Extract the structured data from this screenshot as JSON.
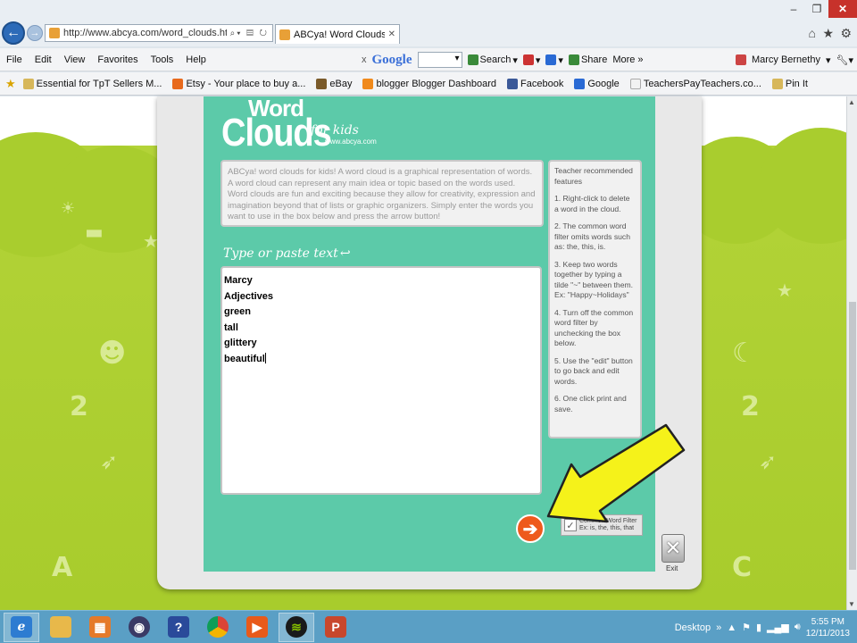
{
  "browser": {
    "url": "http://www.abcya.com/word_clouds.htm",
    "tab_title": "ABCya! Word Clouds for Ki...",
    "menu": [
      "File",
      "Edit",
      "View",
      "Favorites",
      "Tools",
      "Help"
    ],
    "google_toolbar": {
      "close": "x",
      "logo": "Google",
      "search_label": "Search",
      "share_label": "Share",
      "more_label": "More »"
    },
    "user_name": "Marcy Bernethy",
    "favorites": [
      "Essential for TpT Sellers M...",
      "Etsy - Your place to buy a...",
      "eBay",
      "blogger Blogger Dashboard",
      "Facebook",
      "Google",
      "TeachersPayTeachers.co...",
      "Pin It"
    ]
  },
  "app": {
    "logo_word": "Word",
    "logo_clouds": "Clouds",
    "logo_for_kids": "for kids",
    "logo_url": "www.abcya.com",
    "description": "ABCya! word clouds for kids! A word cloud is a graphical representation of words.  A word cloud can represent any main idea or topic based on the words used.  Word clouds are fun and exciting because they allow for creativity, expression and imagination beyond that of lists or graphic organizers.  Simply enter the words you want to use in the box below and press the arrow button!",
    "input_label": "Type or paste text",
    "text_lines": [
      "Marcy",
      "Adjectives",
      "green",
      "tall",
      "glittery",
      "beautiful"
    ],
    "tips": [
      "Teacher recommended features",
      "1. Right-click to delete a word in the cloud.",
      "2. The common word filter omits words such as: the, this, is.",
      "3. Keep two words together by typing a tilde \"~\" between them.\nEx:  \"Happy~Holidays\"",
      "4. Turn off the common word filter by unchecking the box below.",
      "5. Use the \"edit\" button to go back and edit words.",
      "6. One click print and save."
    ],
    "filter_label": "Common Word Filter",
    "filter_example": "Ex: is, the, this, that",
    "filter_checked": true,
    "exit_label": "Exit"
  },
  "taskbar": {
    "desktop_label": "Desktop",
    "time": "5:55 PM",
    "date": "12/11/2013"
  },
  "colors": {
    "app_bg": "#5ccaa9",
    "go_button": "#ee5a1c",
    "annotation_arrow": "#f5f21a",
    "taskbar": "#5a9fc5"
  }
}
